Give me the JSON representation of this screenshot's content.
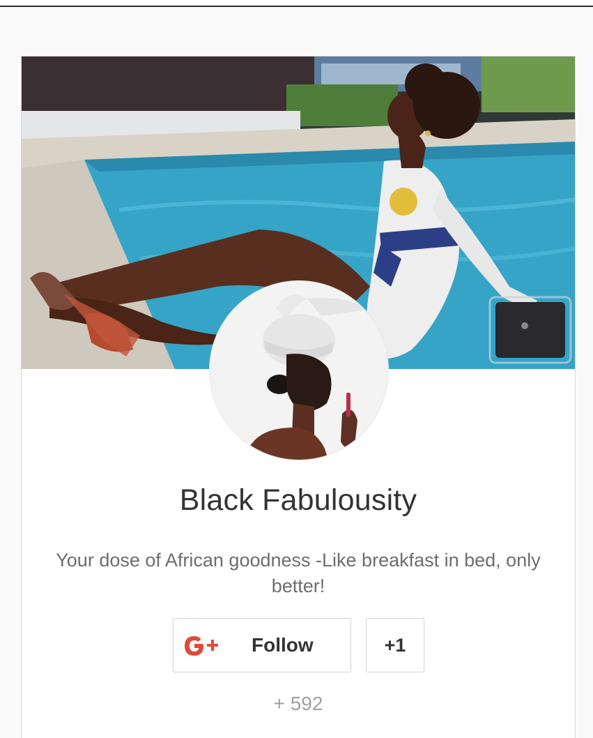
{
  "profile": {
    "name": "Black Fabulousity",
    "tagline": "Your dose of African goodness -Like breakfast in bed, only better!",
    "cover_image": "woman-by-pool-photo",
    "avatar_image": "woman-white-headwrap-photo"
  },
  "actions": {
    "follow_label": "Follow",
    "plus_one_label": "+1",
    "follower_count": "+ 592",
    "gplus_icon": "google-plus-icon"
  },
  "colors": {
    "gplus_red": "#dd4b39",
    "pool_blue": "#36a9c9",
    "text_dark": "#333333",
    "text_muted": "#6d6d6d",
    "count_grey": "#a0a0a0"
  }
}
